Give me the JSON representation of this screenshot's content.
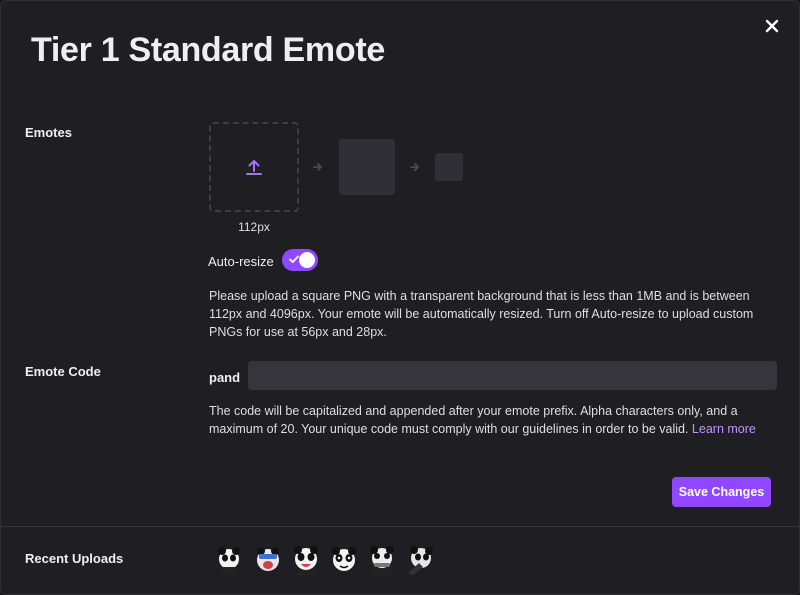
{
  "modal": {
    "title": "Tier 1 Standard Emote",
    "close_icon": "close-icon"
  },
  "emotes": {
    "label": "Emotes",
    "upload_icon": "upload-icon",
    "size_label": "112px",
    "auto_resize_label": "Auto-resize",
    "auto_resize_on": true,
    "help_text": "Please upload a square PNG with a transparent background that is less than 1MB and is between 112px and 4096px. Your emote will be automatically resized. Turn off Auto-resize to upload custom PNGs for use at 56px and 28px."
  },
  "emote_code": {
    "label": "Emote Code",
    "prefix": "pand",
    "value": "",
    "help_text": "The code will be capitalized and appended after your emote prefix. Alpha characters only, and a maximum of 20. Your unique code must comply with our guidelines in order to be valid.",
    "learn_more": "Learn more"
  },
  "actions": {
    "save_label": "Save Changes"
  },
  "recent": {
    "label": "Recent Uploads",
    "emotes": [
      "panda-emote-1",
      "panda-emote-2",
      "panda-emote-3",
      "panda-emote-4",
      "panda-emote-5",
      "panda-emote-6"
    ]
  },
  "colors": {
    "accent": "#9147ff",
    "link": "#bf94ff",
    "background": "#1f1f23"
  }
}
